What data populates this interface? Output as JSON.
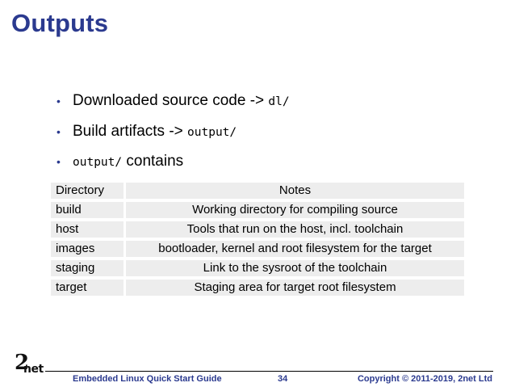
{
  "slide": {
    "title": "Outputs",
    "bullets": [
      {
        "text": "Downloaded source code -> ",
        "code": "dl/",
        "code_first": false
      },
      {
        "text": "Build artifacts -> ",
        "code": "output/",
        "code_first": false
      },
      {
        "text": " contains",
        "code": "output/",
        "code_first": true
      }
    ]
  },
  "table": {
    "headers": [
      "Directory",
      "Notes"
    ],
    "rows": [
      [
        "build",
        "Working directory for compiling source"
      ],
      [
        "host",
        "Tools that run on the host, incl. toolchain"
      ],
      [
        "images",
        "bootloader, kernel and root filesystem for the target"
      ],
      [
        "staging",
        "Link to the sysroot of the toolchain"
      ],
      [
        "target",
        "Staging area for target root filesystem"
      ]
    ]
  },
  "footer": {
    "logo_two": "2",
    "logo_net": "net",
    "left": "Embedded Linux Quick Start Guide",
    "page": "34",
    "right": "Copyright © 2011-2019, 2net Ltd"
  },
  "colors": {
    "accent": "#2b3a8f",
    "table_cell": "#ededed"
  }
}
